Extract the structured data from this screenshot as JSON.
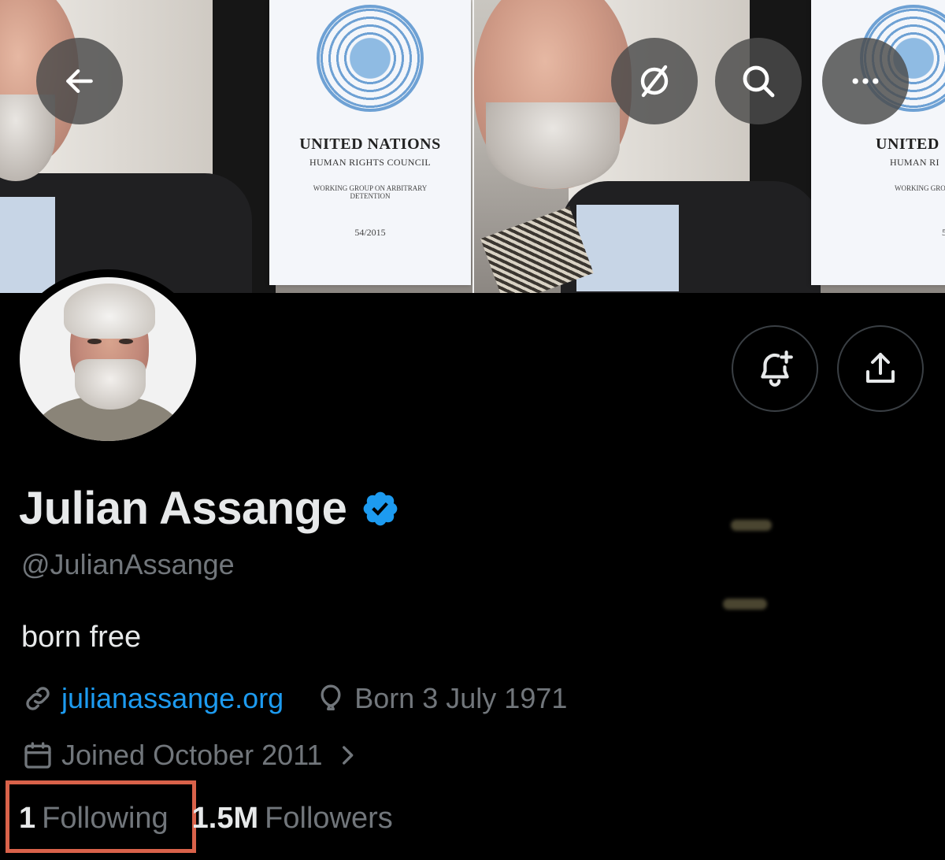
{
  "banner": {
    "document": {
      "title": "UNITED NATIONS",
      "subtitle": "HUMAN RIGHTS COUNCIL",
      "group": "WORKING GROUP ON ARBITRARY DETENTION",
      "number": "54/2015",
      "title_cropped": "UNITED",
      "subtitle_cropped": "HUMAN RI",
      "group_cropped": "WORKING GRO",
      "number_cropped": "5"
    }
  },
  "top_bar": {
    "back_icon": "arrow-left-icon",
    "grok_icon": "slash-circle-icon",
    "search_icon": "search-icon",
    "more_icon": "more-horizontal-icon"
  },
  "actions": {
    "notify_icon": "bell-plus-icon",
    "share_icon": "share-upload-icon"
  },
  "profile": {
    "name": "Julian Assange",
    "handle": "@JulianAssange",
    "bio": "born free",
    "website": "julianassange.org",
    "birth": "Born 3 July 1971",
    "joined": "Joined October 2011",
    "following_count": "1",
    "following_label": "Following",
    "followers_count": "1.5M",
    "followers_label": "Followers"
  },
  "colors": {
    "background": "#000000",
    "text_primary": "#e7e9ea",
    "text_secondary": "#71767b",
    "link": "#1d9bf0",
    "verified": "#1d9bf0",
    "highlight": "#d9624a"
  }
}
